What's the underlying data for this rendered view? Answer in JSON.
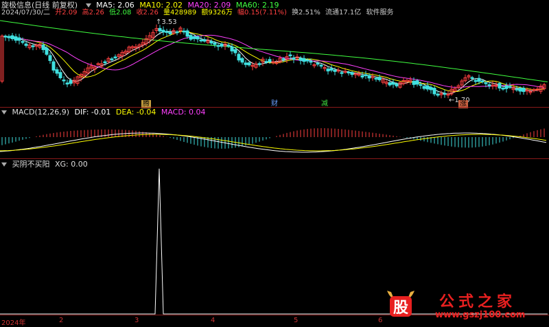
{
  "header": {
    "title": "旋极信息(日线 前复权)",
    "ma5": "MA5: 2.06",
    "ma10": "MA10: 2.02",
    "ma20": "MA20: 2.09",
    "ma60": "MA60: 2.19",
    "date": "2024/07/30/二",
    "open": "开2.09",
    "high": "高2.26",
    "low": "低2.08",
    "close": "收2.26",
    "volume": "量428989",
    "amount": "额9326万",
    "change": "幅0.15(7.11%)",
    "turnover": "换2.51%",
    "float": "流通17.1亿",
    "service": "软件服务"
  },
  "annotations": {
    "high_label": "3.53",
    "low_label": "1.70"
  },
  "tags": {
    "t1": "腾",
    "t2": "财",
    "t3": "减",
    "t4": "涨"
  },
  "macd": {
    "title": "MACD(12,26,9)",
    "dif": "DIF: -0.01",
    "dea": "DEA: -0.04",
    "macd": "MACD: 0.04"
  },
  "indicator": {
    "title": "买阴不买阳",
    "xg": "XG: 0.00"
  },
  "xaxis": {
    "labels": [
      "2024年",
      "2",
      "3",
      "4",
      "5",
      "6"
    ]
  },
  "watermark": {
    "logo": "股",
    "text": "公式之家",
    "url": "www.gszj100.com"
  },
  "colors": {
    "up": "#ff4040",
    "down": "#40e0e0",
    "ma5": "#ffffff",
    "ma10": "#ffff00",
    "ma20": "#ff40ff",
    "ma60": "#40ff40"
  }
}
